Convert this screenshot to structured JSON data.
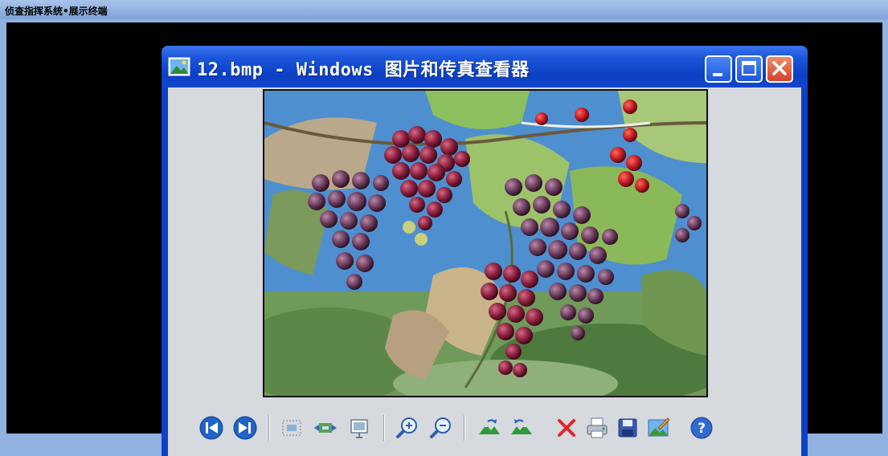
{
  "app": {
    "title": "侦查指挥系统•展示终端"
  },
  "window": {
    "title": "12.bmp - Windows 图片和传真查看器",
    "controls": [
      "minimize",
      "maximize",
      "close"
    ]
  },
  "toolbar": {
    "buttons": [
      {
        "name": "previous-image",
        "icon": "previous-icon"
      },
      {
        "name": "next-image",
        "icon": "next-icon"
      },
      {
        "name": "best-fit",
        "icon": "best-fit-icon"
      },
      {
        "name": "actual-size",
        "icon": "actual-size-icon"
      },
      {
        "name": "slideshow",
        "icon": "slideshow-icon"
      },
      {
        "name": "zoom-in",
        "icon": "zoom-in-icon"
      },
      {
        "name": "zoom-out",
        "icon": "zoom-out-icon"
      },
      {
        "name": "rotate-clockwise",
        "icon": "rotate-cw-icon"
      },
      {
        "name": "rotate-counterclockwise",
        "icon": "rotate-ccw-icon"
      },
      {
        "name": "delete",
        "icon": "delete-icon"
      },
      {
        "name": "print",
        "icon": "print-icon"
      },
      {
        "name": "save",
        "icon": "save-icon"
      },
      {
        "name": "edit",
        "icon": "edit-icon"
      },
      {
        "name": "help",
        "icon": "help-icon"
      }
    ]
  },
  "colors": {
    "titlebar": "#0c3fc4",
    "client": "#d6d9de",
    "screen": "#000000",
    "topbar": "#8fb2e0",
    "close_button": "#d4432a"
  }
}
